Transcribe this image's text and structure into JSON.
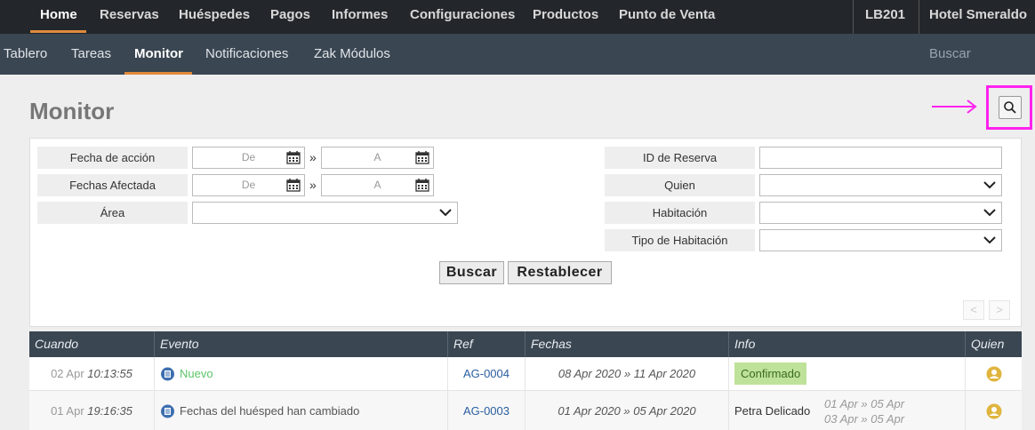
{
  "topnav": {
    "items": [
      "Home",
      "Reservas",
      "Huéspedes",
      "Pagos",
      "Informes",
      "Configuraciones",
      "Productos",
      "Punto de Venta"
    ],
    "room": "LB201",
    "hotel": "Hotel Smeraldo"
  },
  "subnav": {
    "items": [
      "Tablero",
      "Tareas",
      "Monitor",
      "Notificaciones",
      "Zak Módulos"
    ],
    "search": "Buscar"
  },
  "page": {
    "title": "Monitor"
  },
  "colors": {
    "accent": "#e08a3c",
    "highlight": "#ff22ee",
    "badge": "#bfe29a",
    "nav": "#23272b",
    "subnav": "#3a4652"
  },
  "filters": {
    "fecha_accion": "Fecha de acción",
    "fechas_afectada": "Fechas Afectada",
    "area": "Área",
    "id_reserva": "ID de Reserva",
    "quien": "Quien",
    "habitacion": "Habitación",
    "tipo_habitacion": "Tipo de Habitación",
    "from_placeholder": "De",
    "to_placeholder": "A",
    "range_sep": "»",
    "buscar": "Buscar",
    "restablecer": "Restablecer",
    "prev": "<",
    "next": ">"
  },
  "table": {
    "headers": [
      "Cuando",
      "Evento",
      "Ref",
      "Fechas",
      "Info",
      "Quien"
    ],
    "rows": [
      {
        "day": "02 Apr",
        "time": "10:13:55",
        "event": "Nuevo",
        "ref": "AG-0004",
        "dates": "08 Apr 2020 » 11 Apr 2020",
        "info": "Confirmado",
        "info_dates": []
      },
      {
        "day": "01 Apr",
        "time": "19:16:35",
        "event": "Fechas del huésped han cambiado",
        "ref": "AG-0003",
        "dates": "01 Apr 2020 » 05 Apr 2020",
        "info": "Petra Delicado",
        "info_dates": [
          "01 Apr » 05 Apr",
          "03 Apr » 05 Apr"
        ]
      }
    ]
  }
}
